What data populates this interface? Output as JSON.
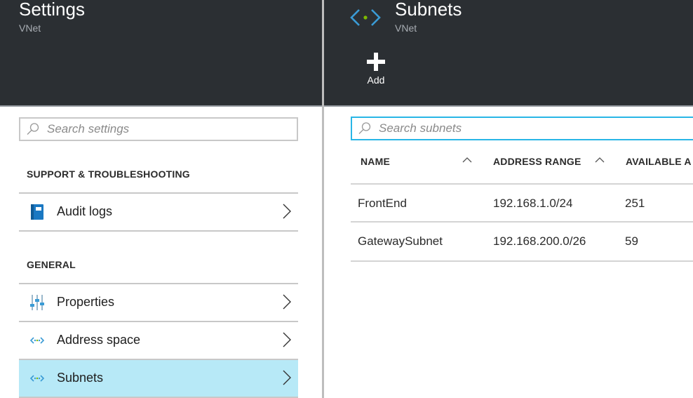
{
  "left_blade": {
    "title": "Settings",
    "subtitle": "VNet",
    "search": {
      "placeholder": "Search settings",
      "value": ""
    },
    "sections": [
      {
        "heading": "SUPPORT & TROUBLESHOOTING",
        "items": [
          {
            "label": "Audit logs",
            "icon": "audit-logs-book-icon"
          }
        ]
      },
      {
        "heading": "GENERAL",
        "items": [
          {
            "label": "Properties",
            "icon": "properties-sliders-icon"
          },
          {
            "label": "Address space",
            "icon": "address-space-icon"
          },
          {
            "label": "Subnets",
            "icon": "subnets-icon",
            "selected": true
          }
        ]
      }
    ]
  },
  "right_blade": {
    "title": "Subnets",
    "subtitle": "VNet",
    "title_icon": "virtual-network-icon",
    "toolbar": {
      "add_label": "Add",
      "add_icon": "plus-icon"
    },
    "search": {
      "placeholder": "Search subnets",
      "value": ""
    },
    "table": {
      "columns": [
        "NAME",
        "ADDRESS RANGE",
        "AVAILABLE A"
      ],
      "rows": [
        [
          "FrontEnd",
          "192.168.1.0/24",
          "251"
        ],
        [
          "GatewaySubnet",
          "192.168.200.0/26",
          "59"
        ]
      ]
    }
  },
  "colors": {
    "header_bg": "#2b2f33",
    "selected_bg": "#b7e9f7",
    "accent": "#29b6e6",
    "vnet_icon_blue": "#3a9bd5",
    "vnet_icon_green": "#7fba00"
  }
}
